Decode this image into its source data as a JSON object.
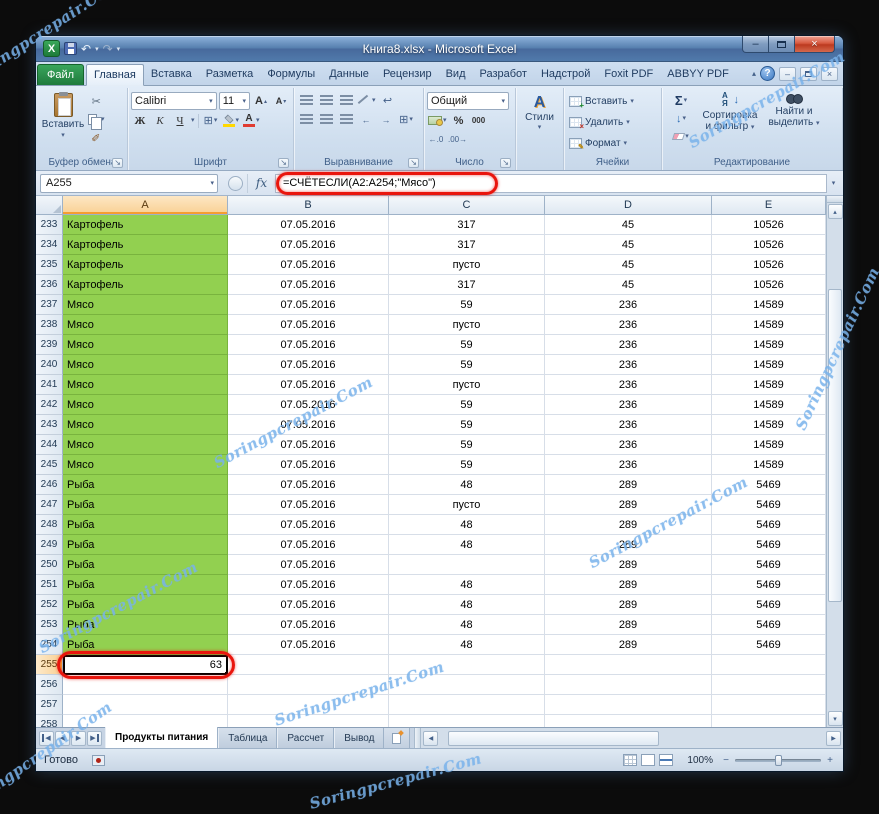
{
  "window": {
    "title": "Книга8.xlsx - Microsoft Excel"
  },
  "ribbon": {
    "file_tab": "Файл",
    "active_tab": "Главная",
    "tabs": [
      "Главная",
      "Вставка",
      "Разметка",
      "Формулы",
      "Данные",
      "Рецензир",
      "Вид",
      "Разработ",
      "Надстрой",
      "Foxit PDF",
      "ABBYY PDF"
    ],
    "groups": {
      "clipboard": {
        "label": "Буфер обмена",
        "paste_label": "Вставить"
      },
      "font": {
        "label": "Шрифт",
        "name": "Calibri",
        "size": "11",
        "bold": "Ж",
        "italic": "К",
        "underline": "Ч"
      },
      "alignment": {
        "label": "Выравнивание"
      },
      "number": {
        "label": "Число",
        "format": "Общий"
      },
      "styles": {
        "label": "Стили"
      },
      "cells": {
        "label": "Ячейки",
        "insert": "Вставить",
        "delete": "Удалить",
        "format": "Формат"
      },
      "editing": {
        "label": "Редактирование",
        "sort_label": "Сортировка и фильтр",
        "find_label": "Найти и выделить"
      }
    }
  },
  "formula_bar": {
    "name_box": "A255",
    "fx": "fx",
    "formula": "=СЧЁТЕСЛИ(A2:A254;\"Мясо\")"
  },
  "sheet": {
    "columns": [
      "A",
      "B",
      "C",
      "D",
      "E"
    ],
    "active_column": "A",
    "active_row": "255",
    "rows": [
      {
        "n": "233",
        "a": "Картофель",
        "b": "07.05.2016",
        "c": "317",
        "d": "45",
        "e": "10526"
      },
      {
        "n": "234",
        "a": "Картофель",
        "b": "07.05.2016",
        "c": "317",
        "d": "45",
        "e": "10526"
      },
      {
        "n": "235",
        "a": "Картофель",
        "b": "07.05.2016",
        "c": "пусто",
        "d": "45",
        "e": "10526"
      },
      {
        "n": "236",
        "a": "Картофель",
        "b": "07.05.2016",
        "c": "317",
        "d": "45",
        "e": "10526"
      },
      {
        "n": "237",
        "a": "Мясо",
        "b": "07.05.2016",
        "c": "59",
        "d": "236",
        "e": "14589"
      },
      {
        "n": "238",
        "a": "Мясо",
        "b": "07.05.2016",
        "c": "пусто",
        "d": "236",
        "e": "14589"
      },
      {
        "n": "239",
        "a": "Мясо",
        "b": "07.05.2016",
        "c": "59",
        "d": "236",
        "e": "14589"
      },
      {
        "n": "240",
        "a": "Мясо",
        "b": "07.05.2016",
        "c": "59",
        "d": "236",
        "e": "14589"
      },
      {
        "n": "241",
        "a": "Мясо",
        "b": "07.05.2016",
        "c": "пусто",
        "d": "236",
        "e": "14589"
      },
      {
        "n": "242",
        "a": "Мясо",
        "b": "07.05.2016",
        "c": "59",
        "d": "236",
        "e": "14589"
      },
      {
        "n": "243",
        "a": "Мясо",
        "b": "07.05.2016",
        "c": "59",
        "d": "236",
        "e": "14589"
      },
      {
        "n": "244",
        "a": "Мясо",
        "b": "07.05.2016",
        "c": "59",
        "d": "236",
        "e": "14589"
      },
      {
        "n": "245",
        "a": "Мясо",
        "b": "07.05.2016",
        "c": "59",
        "d": "236",
        "e": "14589"
      },
      {
        "n": "246",
        "a": "Рыба",
        "b": "07.05.2016",
        "c": "48",
        "d": "289",
        "e": "5469"
      },
      {
        "n": "247",
        "a": "Рыба",
        "b": "07.05.2016",
        "c": "пусто",
        "d": "289",
        "e": "5469"
      },
      {
        "n": "248",
        "a": "Рыба",
        "b": "07.05.2016",
        "c": "48",
        "d": "289",
        "e": "5469"
      },
      {
        "n": "249",
        "a": "Рыба",
        "b": "07.05.2016",
        "c": "48",
        "d": "289",
        "e": "5469"
      },
      {
        "n": "250",
        "a": "Рыба",
        "b": "07.05.2016",
        "c": "",
        "d": "289",
        "e": "5469"
      },
      {
        "n": "251",
        "a": "Рыба",
        "b": "07.05.2016",
        "c": "48",
        "d": "289",
        "e": "5469"
      },
      {
        "n": "252",
        "a": "Рыба",
        "b": "07.05.2016",
        "c": "48",
        "d": "289",
        "e": "5469"
      },
      {
        "n": "253",
        "a": "Рыба",
        "b": "07.05.2016",
        "c": "48",
        "d": "289",
        "e": "5469"
      },
      {
        "n": "254",
        "a": "Рыба",
        "b": "07.05.2016",
        "c": "48",
        "d": "289",
        "e": "5469"
      },
      {
        "n": "255",
        "a": "63",
        "b": "",
        "c": "",
        "d": "",
        "e": ""
      },
      {
        "n": "256",
        "a": "",
        "b": "",
        "c": "",
        "d": "",
        "e": ""
      },
      {
        "n": "257",
        "a": "",
        "b": "",
        "c": "",
        "d": "",
        "e": ""
      },
      {
        "n": "258",
        "a": "",
        "b": "",
        "c": "",
        "d": "",
        "e": ""
      }
    ]
  },
  "sheet_tabs": {
    "tabs": [
      {
        "label": "Продукты питания",
        "active": true
      },
      {
        "label": "Таблица",
        "active": false
      },
      {
        "label": "Рассчет",
        "active": false
      },
      {
        "label": "Вывод",
        "active": false
      }
    ]
  },
  "status_bar": {
    "ready": "Готово",
    "zoom": "100%"
  },
  "watermark": {
    "text": "Soringpcrepair.Com"
  },
  "icons": {
    "dropdown": "▾",
    "launcher": "↘",
    "scissors": "✂",
    "brush": "✎",
    "letter_a": "А",
    "up_small": "▴",
    "down_small": "▾",
    "borders": "⊞",
    "merge": "⊞",
    "wrap": "↩",
    "undo": "↶",
    "redo": "↷",
    "sum": "Σ",
    "fill_down": "↓",
    "percent": "%",
    "thousands": "000",
    "inc_decimal": "←.0",
    "dec_decimal": ".00→",
    "sort_a": "А",
    "sort_z": "Я",
    "arrow_down": "↓",
    "arrow_left": "←",
    "arrow_right": "→",
    "help": "?",
    "close": "×",
    "minimize": "–",
    "tri_left": "◀",
    "tri_right": "▶",
    "minus": "−",
    "plus": "+",
    "excel_logo": "X"
  }
}
